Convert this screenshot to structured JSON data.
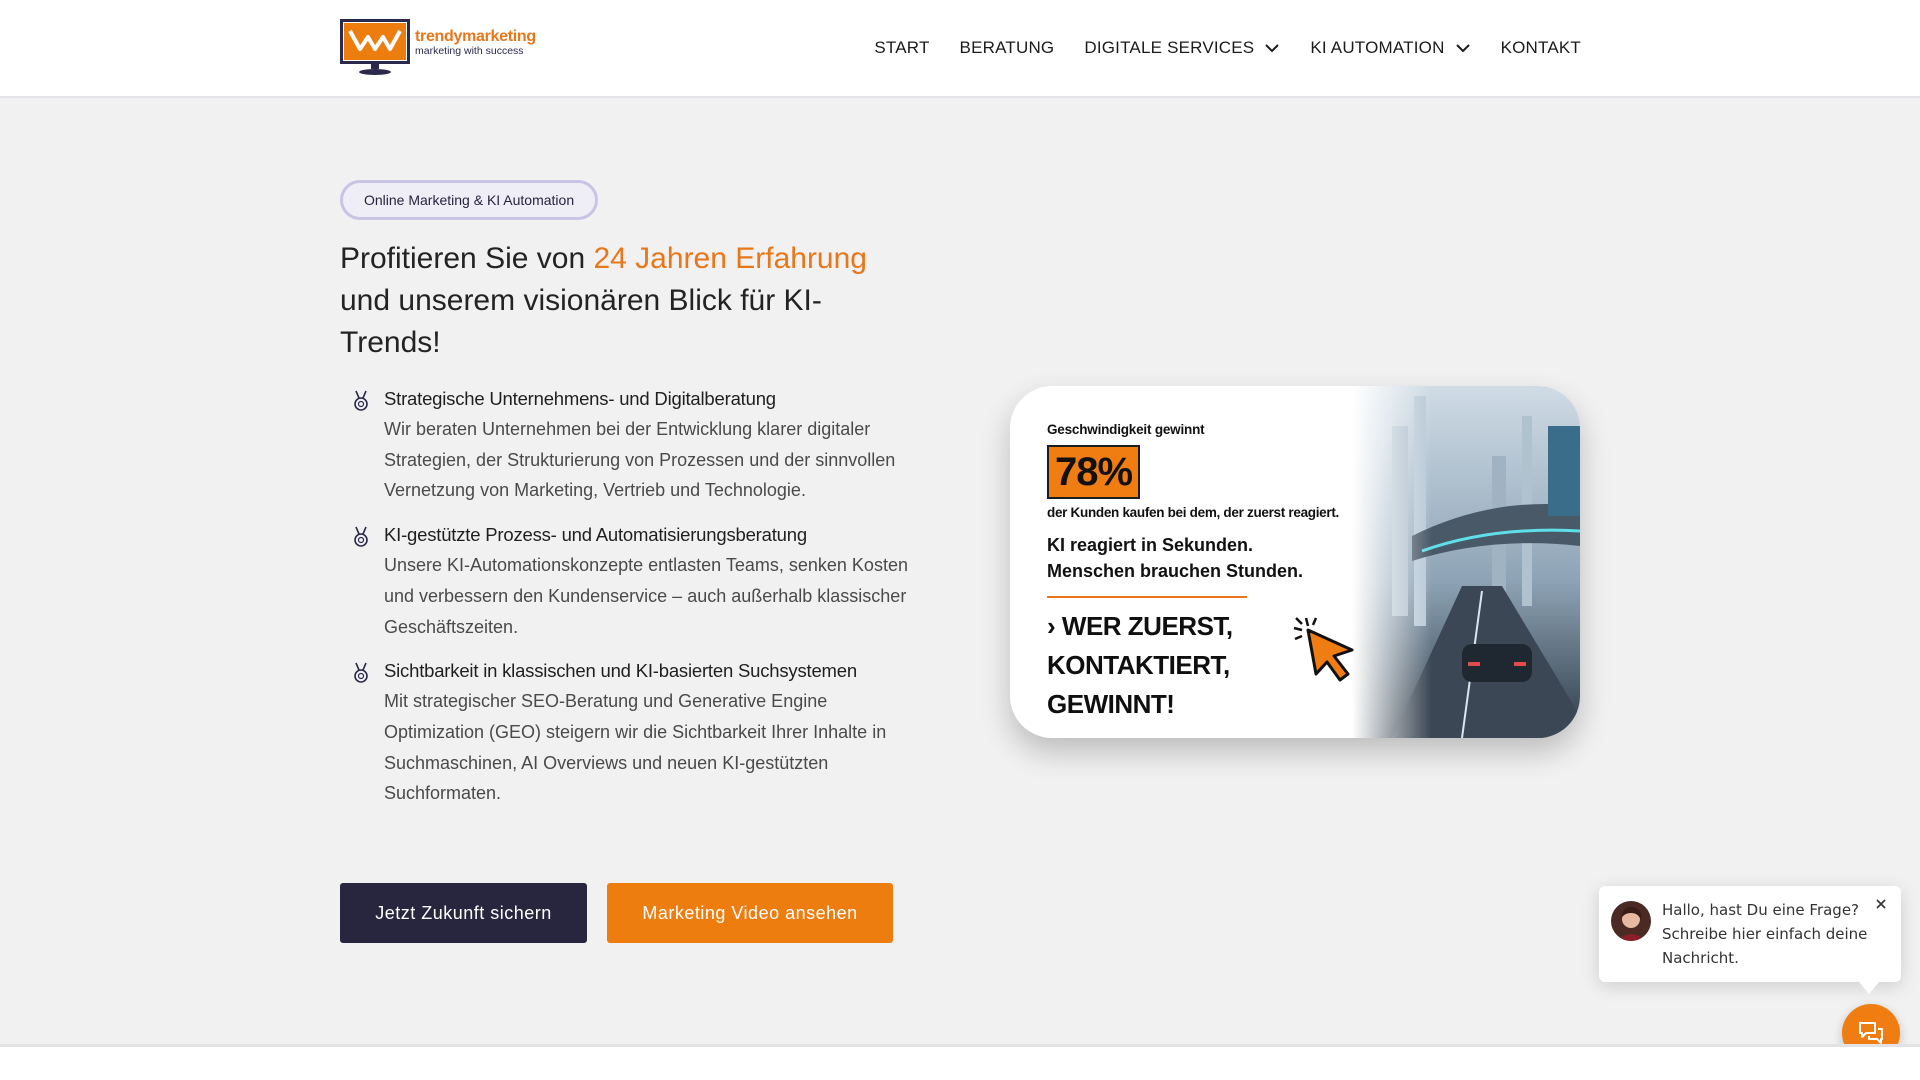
{
  "brand": {
    "name": "trendymarketing",
    "tagline": "marketing with success",
    "accent_color": "#e8771a",
    "dark_color": "#28253f"
  },
  "nav": {
    "items": [
      {
        "label": "START",
        "has_dropdown": false
      },
      {
        "label": "BERATUNG",
        "has_dropdown": false
      },
      {
        "label": "DIGITALE SERVICES",
        "has_dropdown": true
      },
      {
        "label": "KI AUTOMATION",
        "has_dropdown": true
      },
      {
        "label": "KONTAKT",
        "has_dropdown": false
      }
    ]
  },
  "hero": {
    "badge": "Online Marketing & KI Automation",
    "title_prefix": "Profitieren Sie von ",
    "title_accent": "24 Jahren Erfahrung",
    "title_suffix": " und unserem visionären Blick für KI-Trends!",
    "features": [
      {
        "icon": "medal-icon",
        "title": "Strategische Unternehmens- und Digitalberatung",
        "description": "Wir beraten Unternehmen bei der Entwicklung klarer digitaler Strategien, der Strukturierung von Prozessen und der sinnvollen Vernetzung von Marketing, Vertrieb und Technologie."
      },
      {
        "icon": "medal-icon",
        "title": "KI-gestützte Prozess- und Automatisierungsberatung",
        "description": "Unsere KI-Automationskonzepte entlasten Teams, senken Kosten und verbessern den Kundenservice – auch außerhalb klassischer Geschäftszeiten."
      },
      {
        "icon": "medal-icon",
        "title": "Sichtbarkeit in klassischen und KI-basierten Suchsystemen",
        "description": "Mit strategischer SEO-Beratung und Generative Engine Optimization (GEO) steigern wir die Sichtbarkeit Ihrer Inhalte in Suchmaschinen, AI Overviews und neuen KI-gestützten Suchformaten."
      }
    ],
    "primary_button": "Jetzt Zukunft sichern",
    "secondary_button": "Marketing Video ansehen"
  },
  "promo": {
    "kicker": "Geschwindigkeit gewinnt",
    "stat": "78%",
    "stat_text": "der Kunden kaufen bei dem, der zuerst reagiert.",
    "line1": "KI reagiert in Sekunden.",
    "line2": "Menschen brauchen Stunden.",
    "cta_line1": "WER ZUERST,",
    "cta_line2": "KONTAKTIERT,",
    "cta_line3": "GEWINNT!"
  },
  "chat": {
    "line1": "Hallo, hast Du eine Frage?",
    "line2": "Schreibe hier einfach deine Nachricht.",
    "button_color": "#f07d12"
  }
}
